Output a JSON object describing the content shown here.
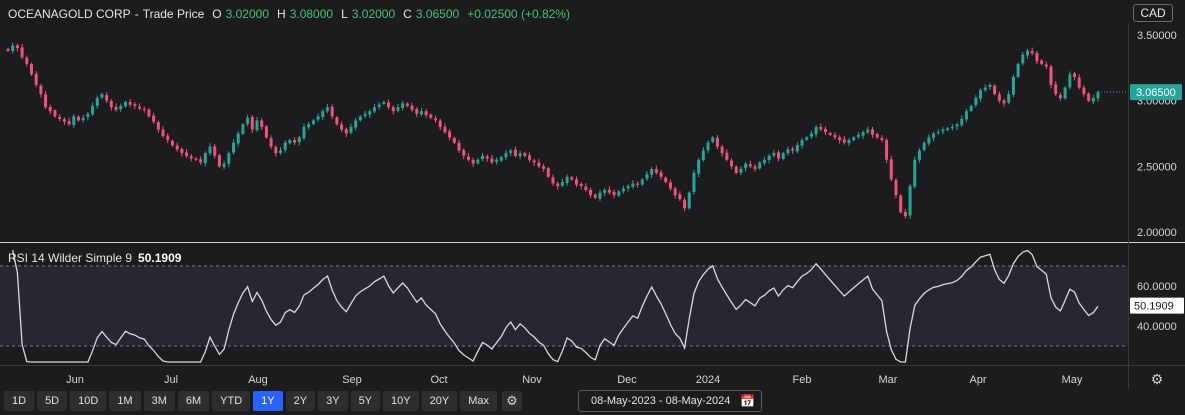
{
  "header": {
    "name": "OCEANAGOLD CORP",
    "separator": "-",
    "price_type": "Trade Price",
    "open_label": "O",
    "open": "3.02000",
    "high_label": "H",
    "high": "3.08000",
    "low_label": "L",
    "low": "3.02000",
    "close_label": "C",
    "close": "3.06500",
    "change": "+0.02500 (+0.82%)"
  },
  "currency": "CAD",
  "colors": {
    "up": "#26a69a",
    "down": "#ef5379",
    "rsi_line": "#d9d9d9",
    "rsi_band": "#2a2532",
    "last_price_bg": "#26a69a",
    "active_range": "#2962ff"
  },
  "chart_data": [
    {
      "type": "candlestick",
      "title": "",
      "x_labels": [
        "Jun",
        "Jul",
        "Aug",
        "Sep",
        "Oct",
        "Nov",
        "Dec",
        "2024",
        "Feb",
        "Mar",
        "Apr",
        "May"
      ],
      "y_ticks": [
        "3.50000",
        "3.00000",
        "2.50000",
        "2.00000"
      ],
      "ylim": [
        1.97,
        3.52
      ],
      "last_price": "3.06500",
      "last_value": 3.065,
      "daily_closes": [
        3.38,
        3.42,
        3.4,
        3.33,
        3.28,
        3.2,
        3.12,
        3.05,
        2.95,
        2.92,
        2.88,
        2.86,
        2.84,
        2.82,
        2.88,
        2.85,
        2.87,
        2.9,
        2.96,
        3.02,
        3.05,
        3.0,
        2.95,
        2.93,
        2.96,
        2.99,
        2.97,
        2.96,
        2.94,
        2.93,
        2.88,
        2.84,
        2.78,
        2.73,
        2.7,
        2.66,
        2.63,
        2.6,
        2.58,
        2.56,
        2.55,
        2.53,
        2.6,
        2.65,
        2.58,
        2.5,
        2.52,
        2.6,
        2.68,
        2.75,
        2.82,
        2.87,
        2.78,
        2.85,
        2.8,
        2.72,
        2.65,
        2.6,
        2.62,
        2.68,
        2.7,
        2.68,
        2.72,
        2.8,
        2.82,
        2.85,
        2.88,
        2.92,
        2.95,
        2.88,
        2.82,
        2.78,
        2.75,
        2.8,
        2.85,
        2.88,
        2.9,
        2.92,
        2.95,
        2.97,
        2.99,
        2.95,
        2.92,
        2.95,
        2.98,
        2.96,
        2.93,
        2.9,
        2.92,
        2.89,
        2.87,
        2.85,
        2.8,
        2.76,
        2.72,
        2.68,
        2.62,
        2.58,
        2.55,
        2.52,
        2.55,
        2.58,
        2.56,
        2.53,
        2.55,
        2.57,
        2.6,
        2.62,
        2.58,
        2.6,
        2.58,
        2.55,
        2.53,
        2.5,
        2.48,
        2.42,
        2.37,
        2.35,
        2.38,
        2.42,
        2.4,
        2.36,
        2.35,
        2.32,
        2.28,
        2.26,
        2.3,
        2.32,
        2.3,
        2.28,
        2.31,
        2.33,
        2.35,
        2.37,
        2.36,
        2.4,
        2.44,
        2.48,
        2.45,
        2.42,
        2.38,
        2.33,
        2.28,
        2.25,
        2.18,
        2.3,
        2.45,
        2.55,
        2.62,
        2.68,
        2.72,
        2.65,
        2.6,
        2.55,
        2.5,
        2.45,
        2.48,
        2.52,
        2.5,
        2.48,
        2.53,
        2.55,
        2.58,
        2.6,
        2.56,
        2.6,
        2.63,
        2.62,
        2.66,
        2.7,
        2.72,
        2.75,
        2.8,
        2.78,
        2.76,
        2.74,
        2.72,
        2.7,
        2.68,
        2.7,
        2.72,
        2.74,
        2.76,
        2.78,
        2.74,
        2.72,
        2.7,
        2.55,
        2.4,
        2.28,
        2.15,
        2.12,
        2.35,
        2.55,
        2.62,
        2.68,
        2.72,
        2.75,
        2.76,
        2.78,
        2.79,
        2.8,
        2.82,
        2.86,
        2.92,
        2.96,
        3.02,
        3.08,
        3.1,
        3.12,
        3.05,
        3.0,
        2.98,
        3.05,
        3.18,
        3.28,
        3.35,
        3.38,
        3.36,
        3.3,
        3.28,
        3.26,
        3.12,
        3.05,
        3.02,
        3.1,
        3.2,
        3.18,
        3.1,
        3.05,
        3.0,
        3.02,
        3.065
      ]
    },
    {
      "type": "line",
      "title": "RSI 14 Wilder Simple 9",
      "value_label": "50.1909",
      "value": 50.1909,
      "y_ticks": [
        "60.0000",
        "40.0000"
      ],
      "ylim": [
        20,
        80
      ],
      "band": [
        30,
        70
      ]
    }
  ],
  "rsi": {
    "label": "RSI 14 Wilder Simple 9",
    "value": "50.1909"
  },
  "ranges": [
    "1D",
    "5D",
    "10D",
    "1M",
    "3M",
    "6M",
    "YTD",
    "1Y",
    "2Y",
    "3Y",
    "5Y",
    "10Y",
    "20Y",
    "Max"
  ],
  "active_range": "1Y",
  "date_range": "08-May-2023 - 08-May-2024"
}
